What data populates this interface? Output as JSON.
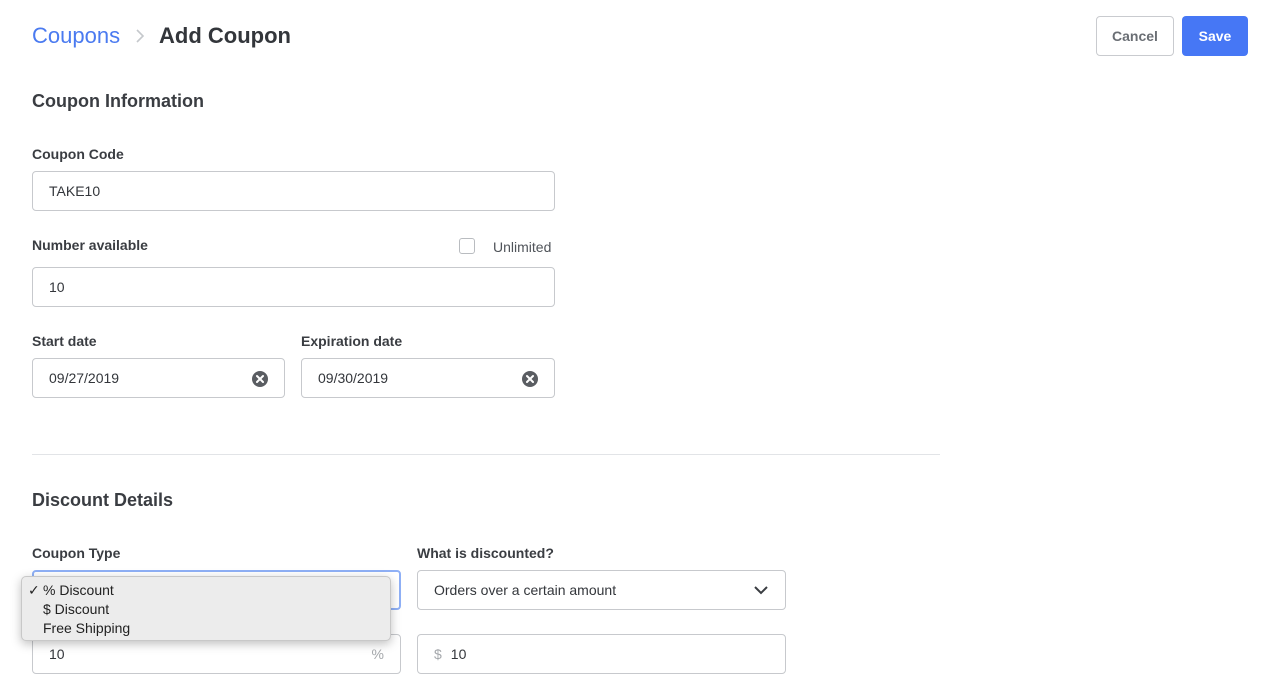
{
  "header": {
    "breadcrumb_parent": "Coupons",
    "breadcrumb_current": "Add Coupon",
    "cancel_label": "Cancel",
    "save_label": "Save"
  },
  "coupon_info": {
    "title": "Coupon Information",
    "code_label": "Coupon Code",
    "code_value": "TAKE10",
    "number_label": "Number available",
    "unlimited_label": "Unlimited",
    "unlimited_checked": false,
    "number_value": "10",
    "start_label": "Start date",
    "start_value": "09/27/2019",
    "expiration_label": "Expiration date",
    "expiration_value": "09/30/2019"
  },
  "discount": {
    "title": "Discount Details",
    "type_label": "Coupon Type",
    "type_options": [
      "% Discount",
      "$ Discount",
      "Free Shipping"
    ],
    "type_selected": "% Discount",
    "check_glyph": "✓",
    "amount_value": "10",
    "amount_suffix": "%",
    "what_label": "What is discounted?",
    "what_value": "Orders over a certain amount",
    "min_prefix": "$",
    "min_value": "10"
  },
  "colors": {
    "accent": "#4677f5",
    "link": "#4a7af0",
    "focus_ring": "#8fb0f6"
  }
}
